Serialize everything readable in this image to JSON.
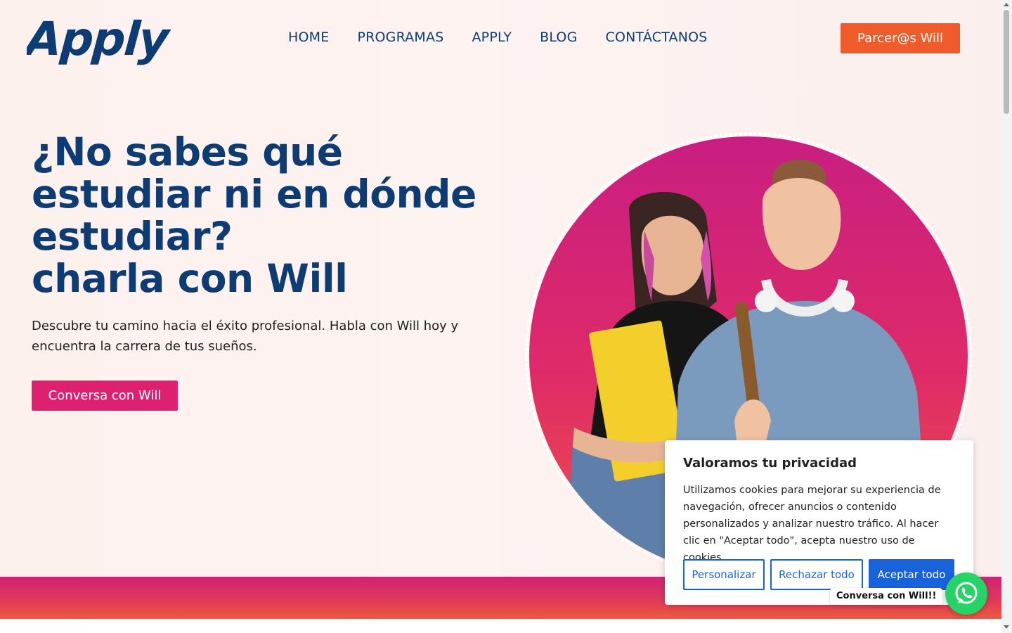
{
  "brand": {
    "logo_text": "Apply",
    "color": "#0d3b73"
  },
  "nav": {
    "items": [
      "HOME",
      "PROGRAMAS",
      "APPLY",
      "BLOG",
      "CONTÁCTANOS"
    ],
    "cta_label": "Parcer@s Will"
  },
  "hero": {
    "title_lines": [
      "¿No sabes qué",
      "estudiar ni en dónde",
      "estudiar?",
      "charla con Will"
    ],
    "subtitle": "Descubre tu camino hacia el éxito profesional. Habla con Will hoy y encuentra la carrera de tus sueños.",
    "cta_label": "Conversa con Will"
  },
  "cookie": {
    "title": "Valoramos tu privacidad",
    "body": "Utilizamos cookies para mejorar su experiencia de navegación, ofrecer anuncios o contenido personalizados y analizar nuestro tráfico. Al hacer clic en \"Aceptar todo\", acepta nuestro uso de cookies.",
    "customize_label": "Personalizar",
    "reject_label": "Rechazar todo",
    "accept_label": "Aceptar todo"
  },
  "whatsapp": {
    "label": "Conversa con Will!!",
    "icon": "whatsapp-icon"
  },
  "colors": {
    "primary_blue": "#0d3b73",
    "orange": "#ef5b2b",
    "pink": "#dd2170",
    "cookie_blue": "#1863dc",
    "whatsapp_green": "#25d366"
  }
}
